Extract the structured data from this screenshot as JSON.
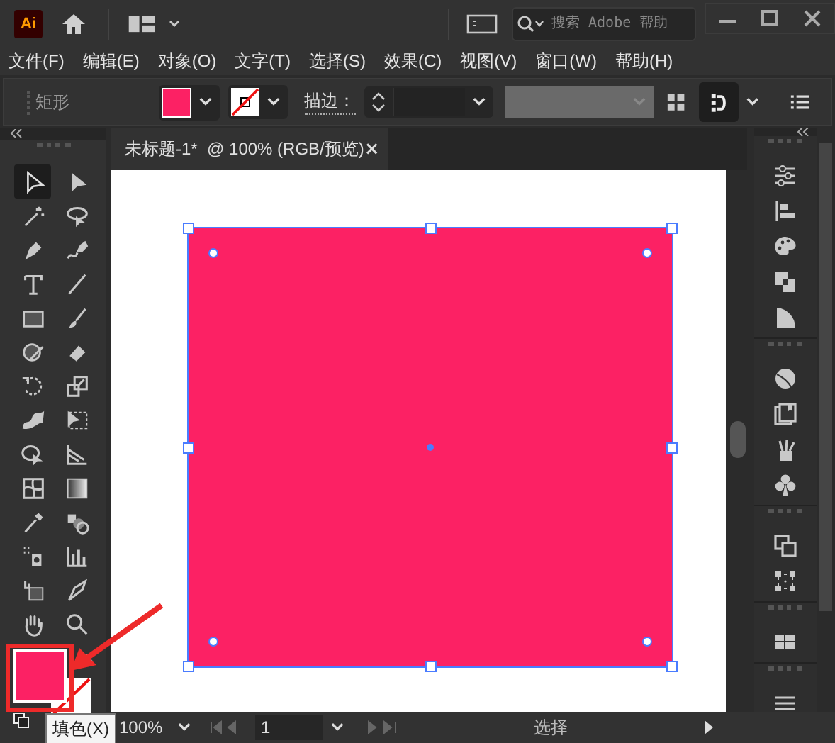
{
  "app": {
    "logo": "Ai"
  },
  "search": {
    "placeholder": "搜索 Adobe 帮助"
  },
  "menu": [
    "文件(F)",
    "编辑(E)",
    "对象(O)",
    "文字(T)",
    "选择(S)",
    "效果(C)",
    "视图(V)",
    "窗口(W)",
    "帮助(H)"
  ],
  "control_bar": {
    "object_type": "矩形",
    "stroke_label": "描边："
  },
  "document_tab": {
    "title": "未标题-1*  @ 100% (RGB/预览)",
    "close": "×"
  },
  "tools": [
    {
      "selected": true
    },
    {
      "selected": false
    },
    {
      "selected": false
    },
    {
      "selected": false
    },
    {
      "selected": false
    },
    {
      "selected": false
    },
    {
      "selected": false
    },
    {
      "selected": false
    },
    {
      "selected": false
    },
    {
      "selected": false
    },
    {
      "selected": false
    },
    {
      "selected": false
    },
    {
      "selected": false
    },
    {
      "selected": false
    },
    {
      "selected": false
    },
    {
      "selected": false
    },
    {
      "selected": false
    },
    {
      "selected": false
    },
    {
      "selected": false
    },
    {
      "selected": false
    },
    {
      "selected": false
    },
    {
      "selected": false
    },
    {
      "selected": false
    },
    {
      "selected": false
    },
    {
      "selected": false
    },
    {
      "selected": false
    },
    {
      "selected": false
    },
    {
      "selected": false
    }
  ],
  "tooltip": "填色(X)",
  "status_bar": {
    "zoom": "100%",
    "page": "1",
    "tool": "选择"
  }
}
